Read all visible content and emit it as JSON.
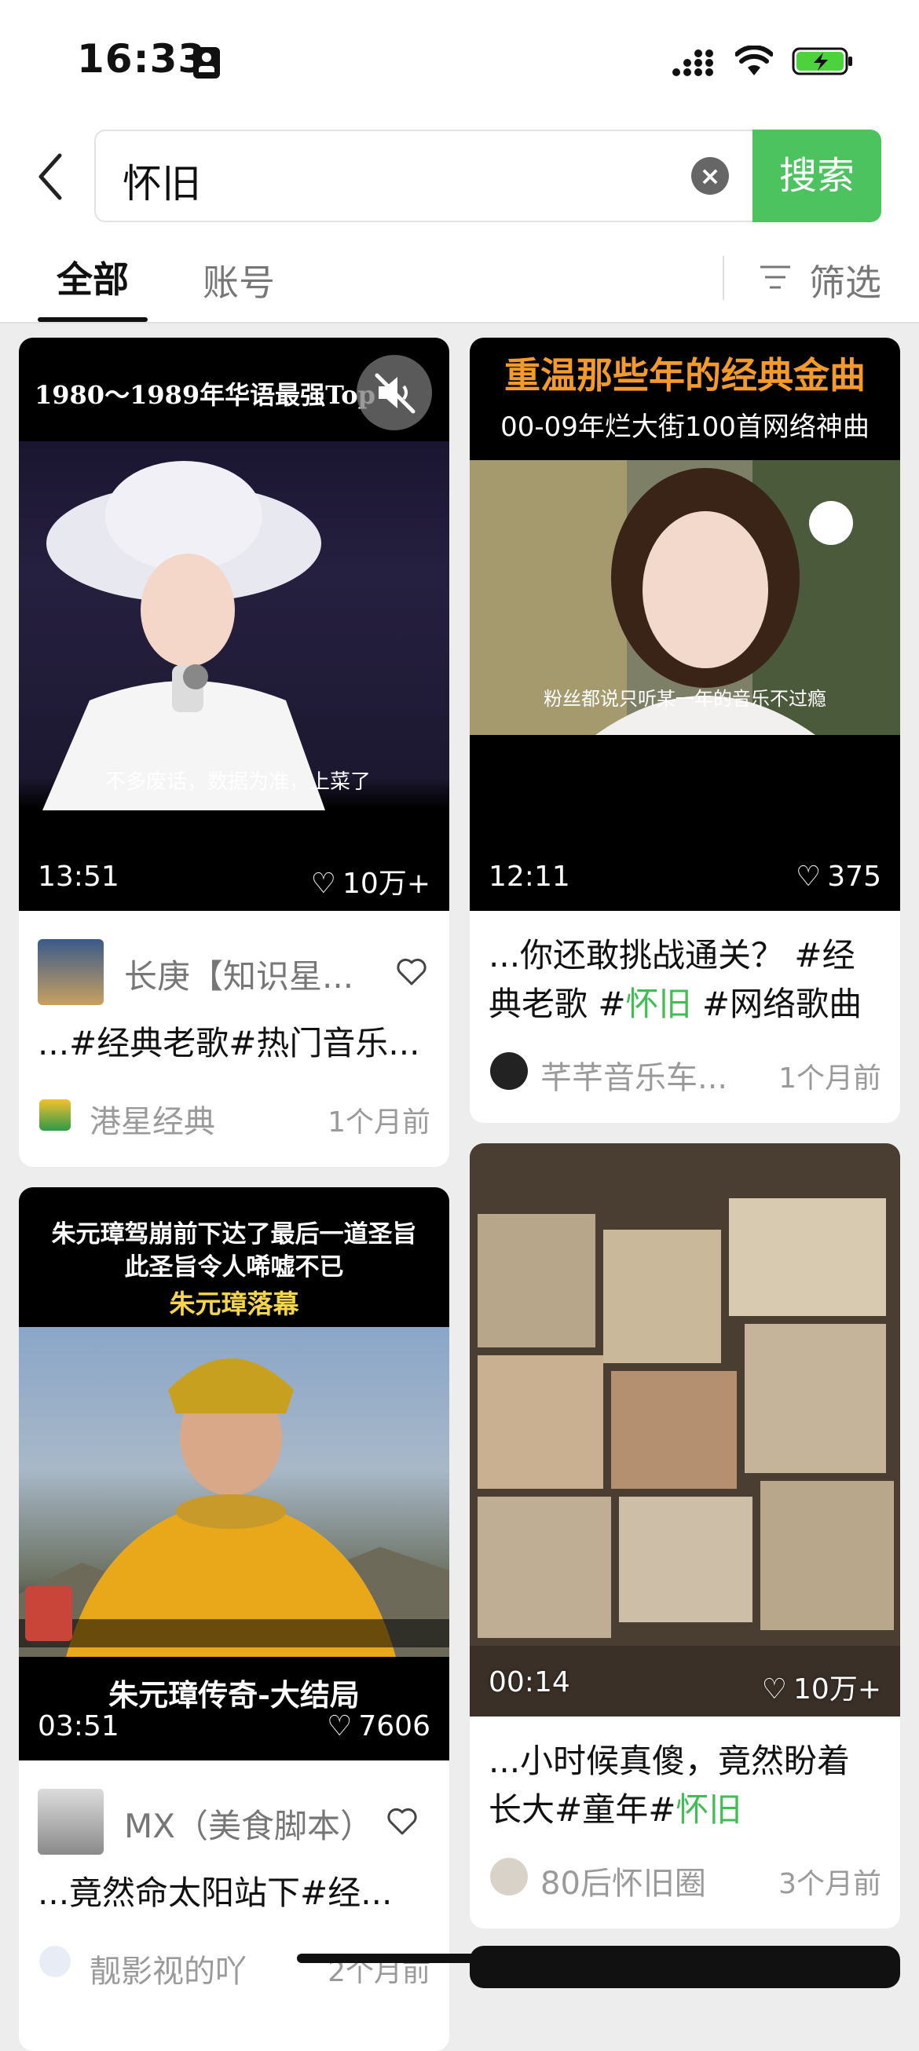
{
  "status": {
    "time": "16:33"
  },
  "search": {
    "query": "怀旧",
    "button": "搜索"
  },
  "tabs": {
    "all": "全部",
    "account": "账号",
    "filter": "筛选"
  },
  "cards": [
    {
      "overlay_title": "1980～1989年华语最强Top",
      "subtitle": "不多废话，数据为准，上菜了",
      "duration": "13:51",
      "likes": "10万+",
      "author": "长庚【知识星...",
      "desc": "...#经典老歌#热门音乐...",
      "source": "港星经典",
      "time": "1个月前"
    },
    {
      "overlay_title": "重温那些年的经典金曲",
      "overlay_sub": "00-09年烂大街100首网络神曲",
      "subtitle": "粉丝都说只听某一年的音乐不过瘾",
      "duration": "12:11",
      "likes": "375",
      "desc_line1": "...你还敢挑战通关？ #经",
      "desc_line2_a": "典老歌 #",
      "desc_line2_b": "怀旧",
      "desc_line2_c": " #网络歌曲",
      "source": "芊芊音乐车...",
      "time": "1个月前"
    },
    {
      "overlay_line1": "朱元璋驾崩前下达了最后一道圣旨",
      "overlay_line2": "此圣旨令人唏嘘不已",
      "overlay_line3": "朱元璋落幕",
      "bottom_title": "朱元璋传奇-大结局",
      "duration": "03:51",
      "likes": "7606",
      "author": "MX（美食脚本）",
      "desc": "...竟然命太阳站下#经...",
      "source": "靓影视的吖",
      "time": "2个月前"
    },
    {
      "duration": "00:14",
      "likes": "10万+",
      "desc_line1": "...小时候真傻，竟然盼着",
      "desc_line2_a": "长大#童年#",
      "desc_line2_b": "怀旧",
      "source": "80后怀旧圈",
      "time": "3个月前"
    }
  ],
  "colors": {
    "accent": "#4cc35f",
    "highlight": "#3fbf53"
  }
}
